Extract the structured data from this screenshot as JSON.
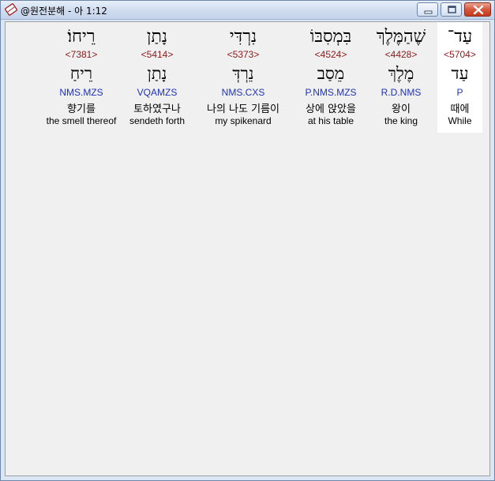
{
  "window": {
    "title": "@원전분해 - 아 1:12",
    "icon": "bible-book-icon"
  },
  "words": [
    {
      "hebrew": "רֵיחוֹ׃",
      "strong": "<7381>",
      "lemma": "רֵיחַ",
      "parse": "NMS.MZS",
      "korean": "향기를",
      "english": "the smell thereof"
    },
    {
      "hebrew": "נָתַן",
      "strong": "<5414>",
      "lemma": "נָתַן",
      "parse": "VQAMZS",
      "korean": "토하였구나",
      "english": "sendeth forth"
    },
    {
      "hebrew": "נִרְדִּי",
      "strong": "<5373>",
      "lemma": "נֵרְדְּ",
      "parse": "NMS.CXS",
      "korean": "나의 나도 기름이",
      "english": "my spikenard"
    },
    {
      "hebrew": "בִּמְסִבּוֹ",
      "strong": "<4524>",
      "lemma": "מֵסַב",
      "parse": "P.NMS.MZS",
      "korean": "상에 앉았을",
      "english": "at his table"
    },
    {
      "hebrew": "שֶׁהַמֶּלֶךְ",
      "strong": "<4428>",
      "lemma": "מֶלֶךְ",
      "parse": "R.D.NMS",
      "korean": "왕이",
      "english": "the king"
    },
    {
      "hebrew": "עַד־",
      "strong": "<5704>",
      "lemma": "עַד",
      "parse": "P",
      "korean": "때에",
      "english": "While"
    }
  ]
}
